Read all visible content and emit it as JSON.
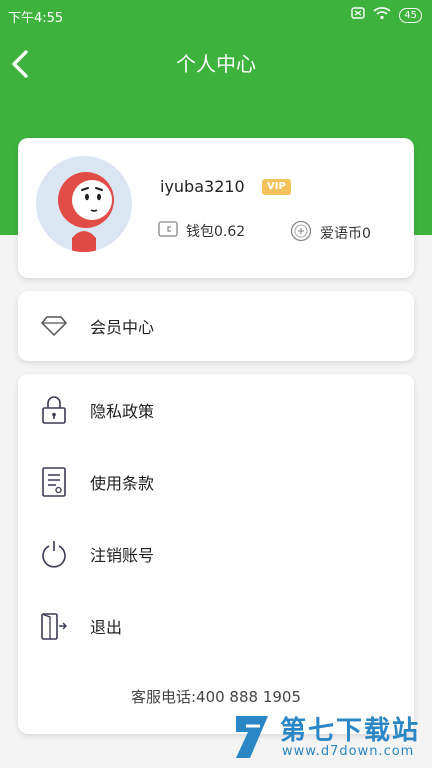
{
  "status_bar": {
    "time": "下午4:55",
    "battery": "45"
  },
  "header": {
    "title": "个人中心"
  },
  "profile": {
    "username": "iyuba3210",
    "vip_badge": "VIP",
    "wallet_label": "钱包0.62",
    "coins_label": "爱语币0"
  },
  "member": {
    "label": "会员中心"
  },
  "menu": {
    "items": [
      {
        "label": "隐私政策",
        "icon": "lock-icon"
      },
      {
        "label": "使用条款",
        "icon": "document-icon"
      },
      {
        "label": "注销账号",
        "icon": "power-icon"
      },
      {
        "label": "退出",
        "icon": "logout-icon"
      }
    ],
    "service_phone": "客服电话:400 888 1905"
  },
  "watermark": {
    "title": "第七下载站",
    "url": "www.d7down.com"
  },
  "colors": {
    "header_green": "#3db33d",
    "vip_gold": "#f3c25a",
    "watermark_blue": "#2b86c5"
  }
}
